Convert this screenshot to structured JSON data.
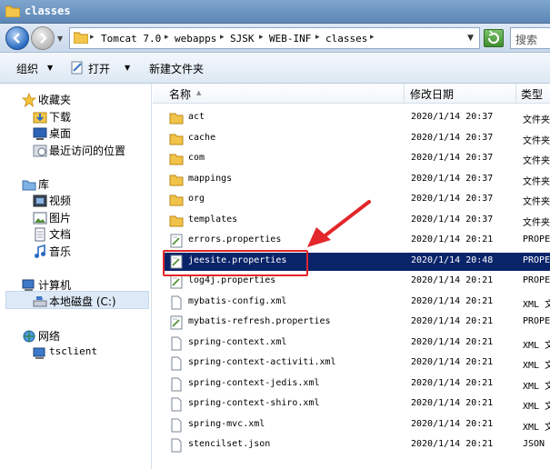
{
  "window": {
    "title": "classes"
  },
  "address": {
    "crumbs": [
      "Tomcat 7.0",
      "webapps",
      "SJSK",
      "WEB-INF",
      "classes"
    ],
    "search_placeholder": "搜索"
  },
  "toolbar": {
    "organize": "组织",
    "open": "打开",
    "new_folder": "新建文件夹"
  },
  "sidebar": {
    "favorites": "收藏夹",
    "downloads": "下载",
    "desktop": "桌面",
    "recent": "最近访问的位置",
    "libraries": "库",
    "videos": "视频",
    "pictures": "图片",
    "documents": "文档",
    "music": "音乐",
    "computer": "计算机",
    "local_disk": "本地磁盘 (C:)",
    "network": "网络",
    "tsclient": "tsclient"
  },
  "columns": {
    "name": "名称",
    "modified": "修改日期",
    "type": "类型"
  },
  "files": [
    {
      "name": "act",
      "date": "2020/1/14 20:37",
      "type": "文件夹",
      "kind": "folder"
    },
    {
      "name": "cache",
      "date": "2020/1/14 20:37",
      "type": "文件夹",
      "kind": "folder"
    },
    {
      "name": "com",
      "date": "2020/1/14 20:37",
      "type": "文件夹",
      "kind": "folder"
    },
    {
      "name": "mappings",
      "date": "2020/1/14 20:37",
      "type": "文件夹",
      "kind": "folder"
    },
    {
      "name": "org",
      "date": "2020/1/14 20:37",
      "type": "文件夹",
      "kind": "folder"
    },
    {
      "name": "templates",
      "date": "2020/1/14 20:37",
      "type": "文件夹",
      "kind": "folder"
    },
    {
      "name": "errors.properties",
      "date": "2020/1/14 20:21",
      "type": "PROPE",
      "kind": "props"
    },
    {
      "name": "jeesite.properties",
      "date": "2020/1/14 20:48",
      "type": "PROPE",
      "kind": "props"
    },
    {
      "name": "log4j.properties",
      "date": "2020/1/14 20:21",
      "type": "PROPE",
      "kind": "props"
    },
    {
      "name": "mybatis-config.xml",
      "date": "2020/1/14 20:21",
      "type": "XML 文",
      "kind": "doc"
    },
    {
      "name": "mybatis-refresh.properties",
      "date": "2020/1/14 20:21",
      "type": "PROPE",
      "kind": "props"
    },
    {
      "name": "spring-context.xml",
      "date": "2020/1/14 20:21",
      "type": "XML 文",
      "kind": "doc"
    },
    {
      "name": "spring-context-activiti.xml",
      "date": "2020/1/14 20:21",
      "type": "XML 文",
      "kind": "doc"
    },
    {
      "name": "spring-context-jedis.xml",
      "date": "2020/1/14 20:21",
      "type": "XML 文",
      "kind": "doc"
    },
    {
      "name": "spring-context-shiro.xml",
      "date": "2020/1/14 20:21",
      "type": "XML 文",
      "kind": "doc"
    },
    {
      "name": "spring-mvc.xml",
      "date": "2020/1/14 20:21",
      "type": "XML 文",
      "kind": "doc"
    },
    {
      "name": "stencilset.json",
      "date": "2020/1/14 20:21",
      "type": "JSON",
      "kind": "doc"
    }
  ],
  "selected_file": "jeesite.properties",
  "colors": {
    "selection": "#0a246a",
    "annotation": "#e3262b"
  }
}
